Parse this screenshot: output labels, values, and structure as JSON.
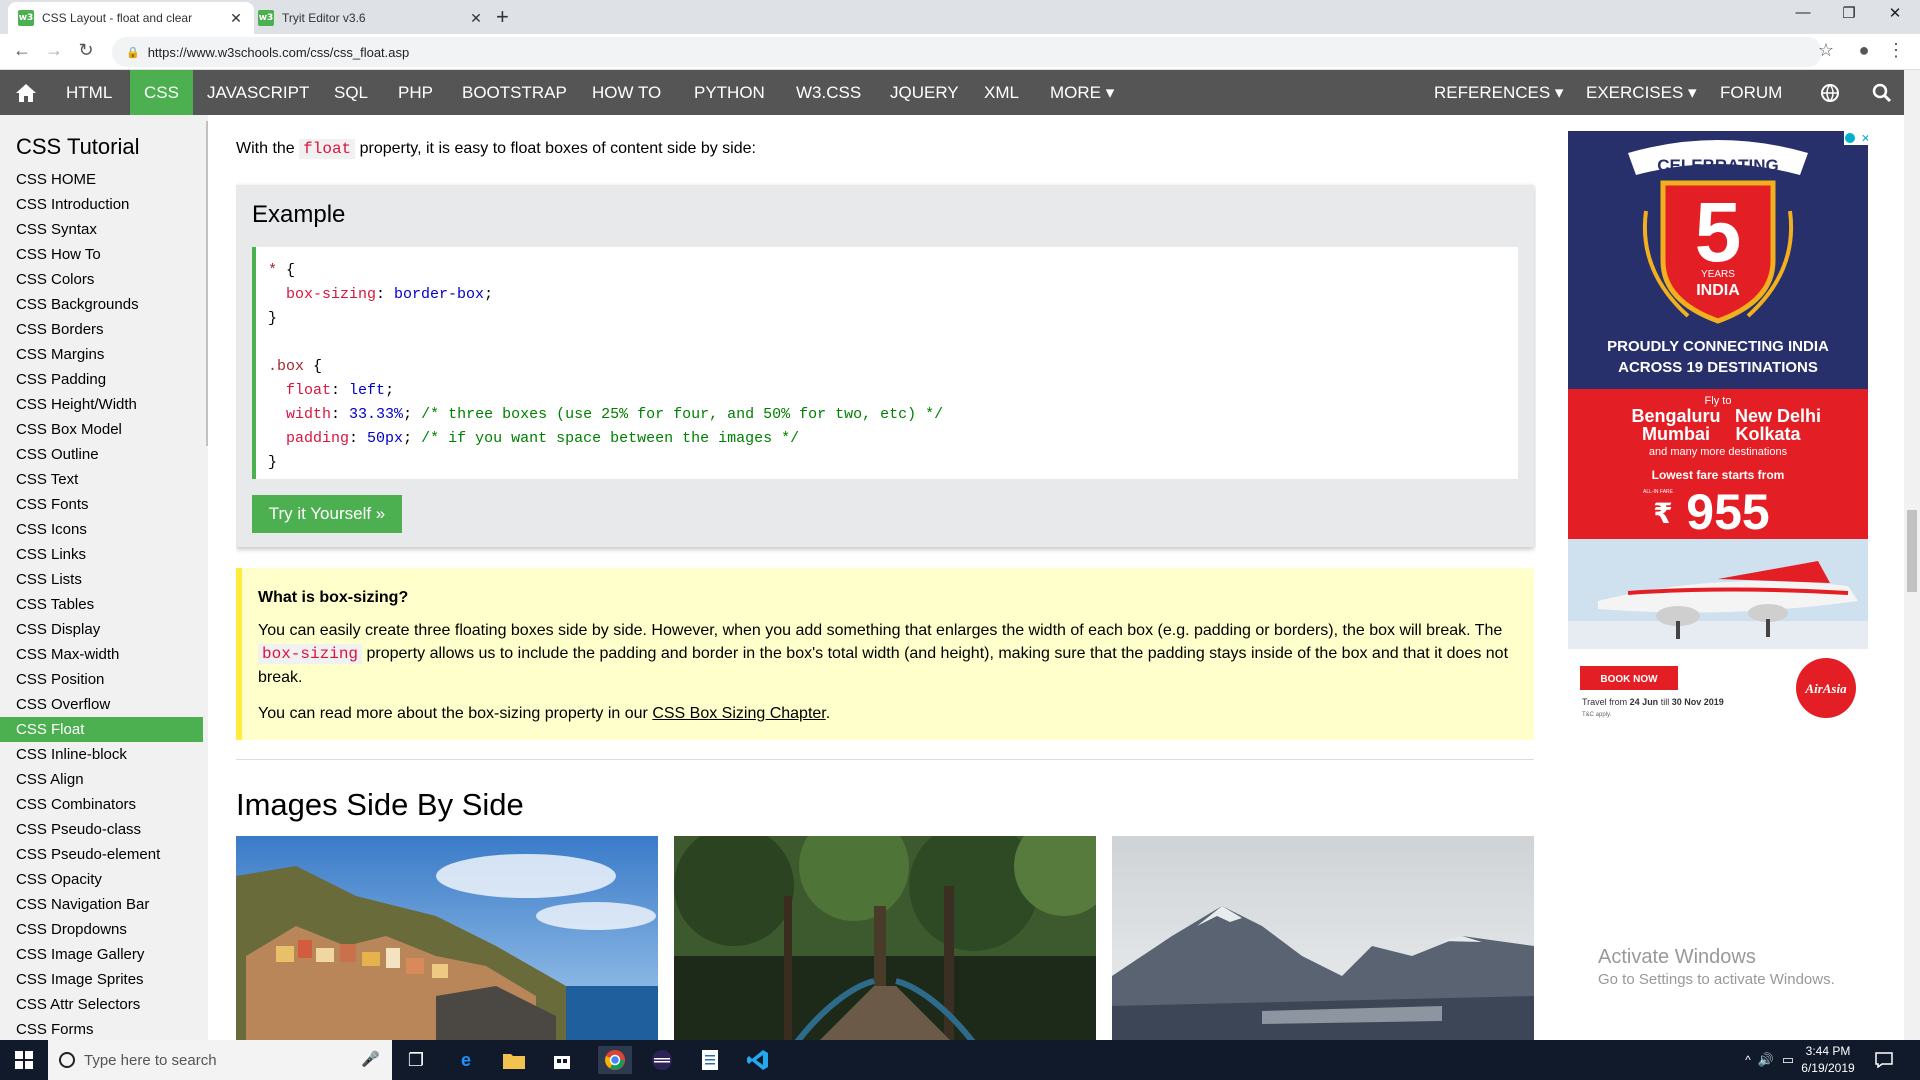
{
  "browser": {
    "tabs": [
      {
        "title": "CSS Layout - float and clear",
        "favicon": "w3"
      },
      {
        "title": "Tryit Editor v3.6",
        "favicon": "w3"
      }
    ],
    "url": "https://www.w3schools.com/css/css_float.asp"
  },
  "topnav": {
    "items": [
      "HTML",
      "CSS",
      "JAVASCRIPT",
      "SQL",
      "PHP",
      "BOOTSTRAP",
      "HOW TO",
      "PYTHON",
      "W3.CSS",
      "JQUERY",
      "XML",
      "MORE ▾"
    ],
    "active": "CSS",
    "right_items": [
      "REFERENCES ▾",
      "EXERCISES ▾",
      "FORUM"
    ]
  },
  "sidebar": {
    "title": "CSS Tutorial",
    "items": [
      "CSS HOME",
      "CSS Introduction",
      "CSS Syntax",
      "CSS How To",
      "CSS Colors",
      "CSS Backgrounds",
      "CSS Borders",
      "CSS Margins",
      "CSS Padding",
      "CSS Height/Width",
      "CSS Box Model",
      "CSS Outline",
      "CSS Text",
      "CSS Fonts",
      "CSS Icons",
      "CSS Links",
      "CSS Lists",
      "CSS Tables",
      "CSS Display",
      "CSS Max-width",
      "CSS Position",
      "CSS Overflow",
      "CSS Float",
      "CSS Inline-block",
      "CSS Align",
      "CSS Combinators",
      "CSS Pseudo-class",
      "CSS Pseudo-element",
      "CSS Opacity",
      "CSS Navigation Bar",
      "CSS Dropdowns",
      "CSS Image Gallery",
      "CSS Image Sprites",
      "CSS Attr Selectors",
      "CSS Forms"
    ],
    "active": "CSS Float"
  },
  "main": {
    "intro_before": "With the ",
    "intro_code": "float",
    "intro_after": " property, it is easy to float boxes of content side by side:",
    "example": {
      "title": "Example",
      "code": {
        "sel1": "*",
        "open_brace": " {",
        "prop1": "box-sizing",
        "val1": "border-box",
        "close_brace": "}",
        "sel2": ".box",
        "prop2": "float",
        "val2": "left",
        "prop3": "width",
        "val3": "33.33%",
        "cmt3": "/* three boxes (use 25% for four, and 50% for two, etc) */",
        "prop4": "padding",
        "val4": "50px",
        "cmt4": "/* if you want space between the images */"
      },
      "try_button": "Try it Yourself »"
    },
    "note": {
      "title": "What is box-sizing?",
      "p1_before": "You can easily create three floating boxes side by side. However, when you add something that enlarges the width of each box (e.g. padding or borders), the box will break. The ",
      "p1_code": "box-sizing",
      "p1_after": " property allows us to include the padding and border in the box's total width (and height), making sure that the padding stays inside of the box and that it does not break.",
      "p2_before": "You can read more about the box-sizing property in our ",
      "p2_link": "CSS Box Sizing Chapter",
      "p2_after": "."
    },
    "images_heading": "Images Side By Side"
  },
  "ad": {
    "celebrating": "CELEBRATING",
    "years_number": "5",
    "years_label": "YEARS",
    "country": "INDIA",
    "tagline1": "PROUDLY CONNECTING INDIA",
    "tagline2": "ACROSS 19 DESTINATIONS",
    "fly_to": "Fly to",
    "dest1": "Bengaluru",
    "dest2": "New Delhi",
    "dest3": "Mumbai",
    "dest4": "Kolkata",
    "more": "and many more destinations",
    "fare_label": "Lowest fare starts from",
    "currency": "₹",
    "fare_tag": "ALL-IN FARE",
    "price": "955",
    "book_now": "BOOK NOW",
    "travel_prefix": "Travel from ",
    "travel_start": "24 Jun",
    "travel_mid": " till ",
    "travel_end": "30 Nov 2019",
    "tnc": "T&C apply.",
    "brand": "AirAsia"
  },
  "watermark": {
    "line1": "Activate Windows",
    "line2": "Go to Settings to activate Windows."
  },
  "taskbar": {
    "search_placeholder": "Type here to search",
    "time": "3:44 PM",
    "date": "6/19/2019"
  },
  "colors": {
    "accent": "#4CAF50",
    "nav_bg": "#555555",
    "note_bg": "#ffffcc",
    "note_border": "#ffeb3b",
    "ad_blue": "#27306b",
    "ad_red": "#e31e24"
  }
}
